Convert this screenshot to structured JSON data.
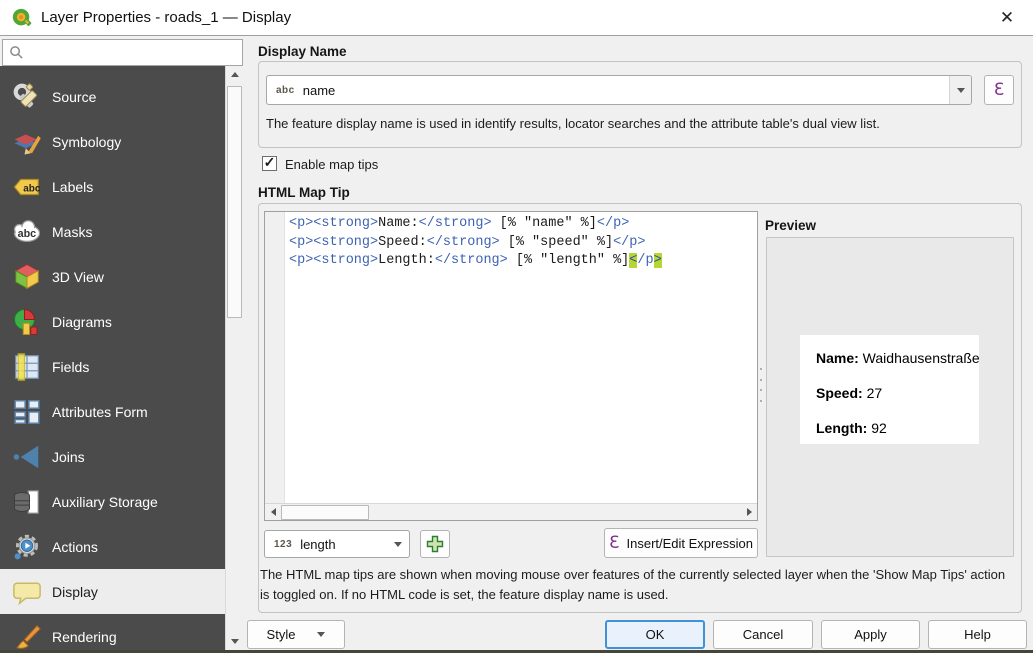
{
  "window": {
    "title": "Layer Properties - roads_1 — Display",
    "close_glyph": "✕"
  },
  "search": {
    "value": "",
    "placeholder": ""
  },
  "sidebar": {
    "selected": "Display",
    "items": [
      {
        "label": "Source",
        "icon": "wrench-icon"
      },
      {
        "label": "Symbology",
        "icon": "symbology-brush-icon"
      },
      {
        "label": "Labels",
        "icon": "labels-tag-icon"
      },
      {
        "label": "Masks",
        "icon": "masks-cloud-icon"
      },
      {
        "label": "3D View",
        "icon": "cube-3d-icon"
      },
      {
        "label": "Diagrams",
        "icon": "pie-chart-icon"
      },
      {
        "label": "Fields",
        "icon": "fields-table-icon"
      },
      {
        "label": "Attributes Form",
        "icon": "attributes-form-icon"
      },
      {
        "label": "Joins",
        "icon": "joins-triangle-icon"
      },
      {
        "label": "Auxiliary Storage",
        "icon": "database-icon"
      },
      {
        "label": "Actions",
        "icon": "actions-gear-icon"
      },
      {
        "label": "Display",
        "icon": "speech-bubble-icon"
      },
      {
        "label": "Rendering",
        "icon": "rendering-brush-icon"
      }
    ]
  },
  "display_name": {
    "header": "Display Name",
    "field_type_badge": "abc",
    "value": "name",
    "expression_glyph": "Ɛ",
    "description": "The feature display name is used in identify results, locator searches and the attribute table's dual view list."
  },
  "map_tips": {
    "checkbox_label": "Enable map tips",
    "checked": true,
    "check_glyph": "✓"
  },
  "html_map_tip": {
    "header": "HTML Map Tip",
    "code_lines": [
      [
        {
          "c": "tag",
          "t": "<p><strong>"
        },
        {
          "c": "txt",
          "t": "Name:"
        },
        {
          "c": "tag",
          "t": "</strong>"
        },
        {
          "c": "txt",
          "t": " [% \"name\" %]"
        },
        {
          "c": "tag",
          "t": "</p>"
        }
      ],
      [
        {
          "c": "tag",
          "t": "<p><strong>"
        },
        {
          "c": "txt",
          "t": "Speed:"
        },
        {
          "c": "tag",
          "t": "</strong>"
        },
        {
          "c": "txt",
          "t": " [% \"speed\" %]"
        },
        {
          "c": "tag",
          "t": "</p>"
        }
      ],
      [
        {
          "c": "tag",
          "t": "<p><strong>"
        },
        {
          "c": "txt",
          "t": "Length:"
        },
        {
          "c": "tag",
          "t": "</strong>"
        },
        {
          "c": "txt",
          "t": " [% \"length\" %]"
        },
        {
          "c": "hl",
          "t": "<"
        },
        {
          "c": "tag",
          "t": "/p"
        },
        {
          "c": "hl",
          "t": ">"
        }
      ]
    ],
    "field_selector": {
      "type_badge": "123",
      "value": "length"
    },
    "insert_expression_label": "Insert/Edit Expression",
    "insert_expression_glyph": "Ɛ",
    "hint": "The HTML map tips are shown when moving mouse over features of the currently selected layer when the 'Show Map Tips' action is toggled on. If no HTML code is set, the feature display name is used."
  },
  "preview": {
    "header": "Preview",
    "rows": [
      {
        "label": "Name:",
        "value": "Waidhausenstraße"
      },
      {
        "label": "Speed:",
        "value": "27"
      },
      {
        "label": "Length:",
        "value": "92"
      }
    ]
  },
  "footer": {
    "style_label": "Style",
    "ok_label": "OK",
    "cancel_label": "Cancel",
    "apply_label": "Apply",
    "help_label": "Help"
  },
  "colors": {
    "sidebar_bg": "#4b4b4b",
    "selected_item_bg": "#ededed",
    "ok_border": "#4092d8",
    "code_tag_blue": "#3e63b2",
    "bracket_highlight": "#b5d633",
    "epsilon_purple": "#80308b",
    "add_button_green": "#2e7d32"
  }
}
